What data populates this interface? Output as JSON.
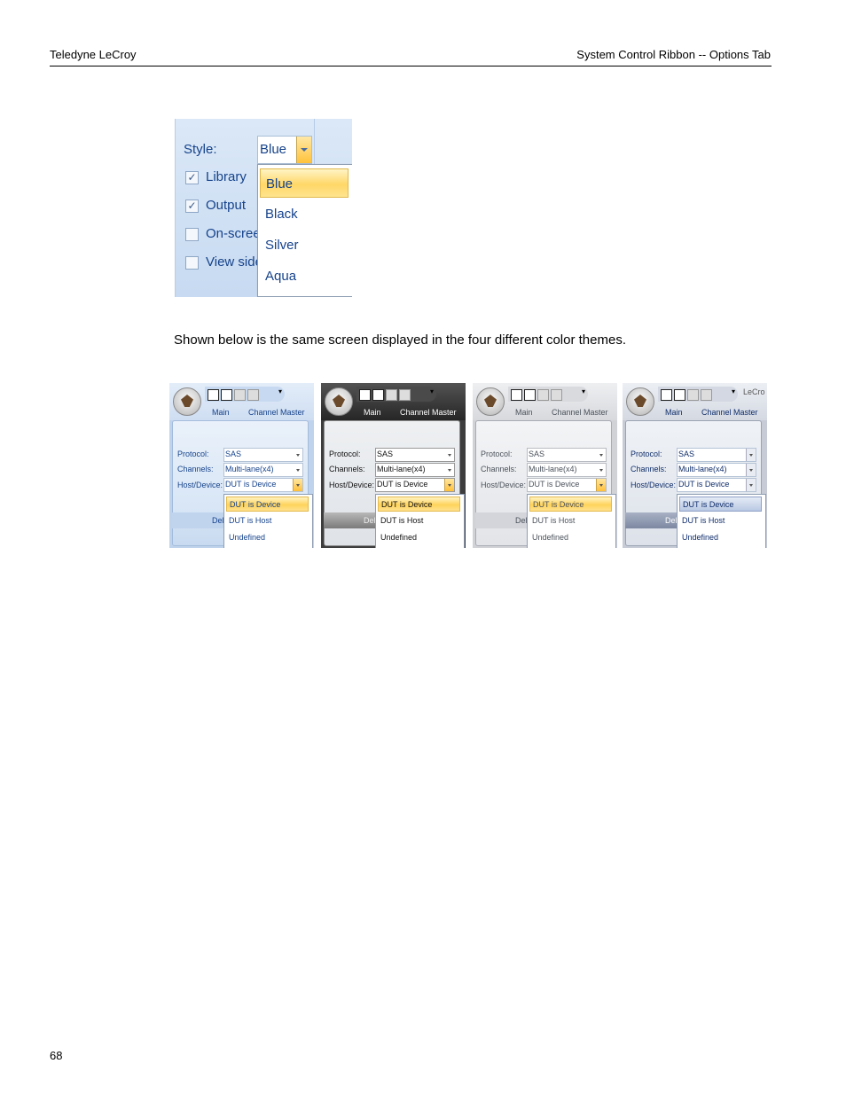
{
  "header": {
    "left": "Teledyne LeCroy",
    "right": "System Control Ribbon -- Options Tab"
  },
  "style_figure": {
    "style_label": "Style:",
    "style_value": "Blue",
    "checkboxes": [
      {
        "label": "Library",
        "checked": true
      },
      {
        "label": "Output",
        "checked": true
      },
      {
        "label": "On-screen",
        "checked": false
      },
      {
        "label": "View side",
        "checked": false
      }
    ],
    "options": [
      "Blue",
      "Black",
      "Silver",
      "Aqua"
    ],
    "selected_option": "Blue"
  },
  "paragraph": "Shown below is the same screen displayed in the four different color themes.",
  "themes": [
    {
      "name": "Blue",
      "tabs": [
        "Main",
        "Channel Master"
      ],
      "fields": [
        {
          "label": "Protocol:",
          "value": "SAS"
        },
        {
          "label": "Channels:",
          "value": "Multi-lane(x4)"
        },
        {
          "label": "Host/Device:",
          "value": "DUT is Device"
        }
      ],
      "footer_text": "Del",
      "dropdown_options": [
        "DUT is Device",
        "DUT is Host",
        "Undefined"
      ],
      "dropdown_selected": "DUT is Device"
    },
    {
      "name": "Black",
      "tabs": [
        "Main",
        "Channel Master"
      ],
      "fields": [
        {
          "label": "Protocol:",
          "value": "SAS"
        },
        {
          "label": "Channels:",
          "value": "Multi-lane(x4)"
        },
        {
          "label": "Host/Device:",
          "value": "DUT is Device"
        }
      ],
      "footer_text": "Del",
      "dropdown_options": [
        "DUT is Device",
        "DUT is Host",
        "Undefined"
      ],
      "dropdown_selected": "DUT is Device"
    },
    {
      "name": "Silver",
      "tabs": [
        "Main",
        "Channel Master"
      ],
      "fields": [
        {
          "label": "Protocol:",
          "value": "SAS"
        },
        {
          "label": "Channels:",
          "value": "Multi-lane(x4)"
        },
        {
          "label": "Host/Device:",
          "value": "DUT is Device"
        }
      ],
      "footer_text": "Del",
      "dropdown_options": [
        "DUT is Device",
        "DUT is Host",
        "Undefined"
      ],
      "dropdown_selected": "DUT is Device"
    },
    {
      "name": "Aqua",
      "window_title_partial": "LeCro",
      "tabs": [
        "Main",
        "Channel Master"
      ],
      "fields": [
        {
          "label": "Protocol:",
          "value": "SAS"
        },
        {
          "label": "Channels:",
          "value": "Multi-lane(x4)"
        },
        {
          "label": "Host/Device:",
          "value": "DUT is Device"
        }
      ],
      "footer_text": "Del",
      "dropdown_options": [
        "DUT is Device",
        "DUT is Host",
        "Undefined"
      ],
      "dropdown_selected": "DUT is Device"
    }
  ],
  "page_number": "68"
}
